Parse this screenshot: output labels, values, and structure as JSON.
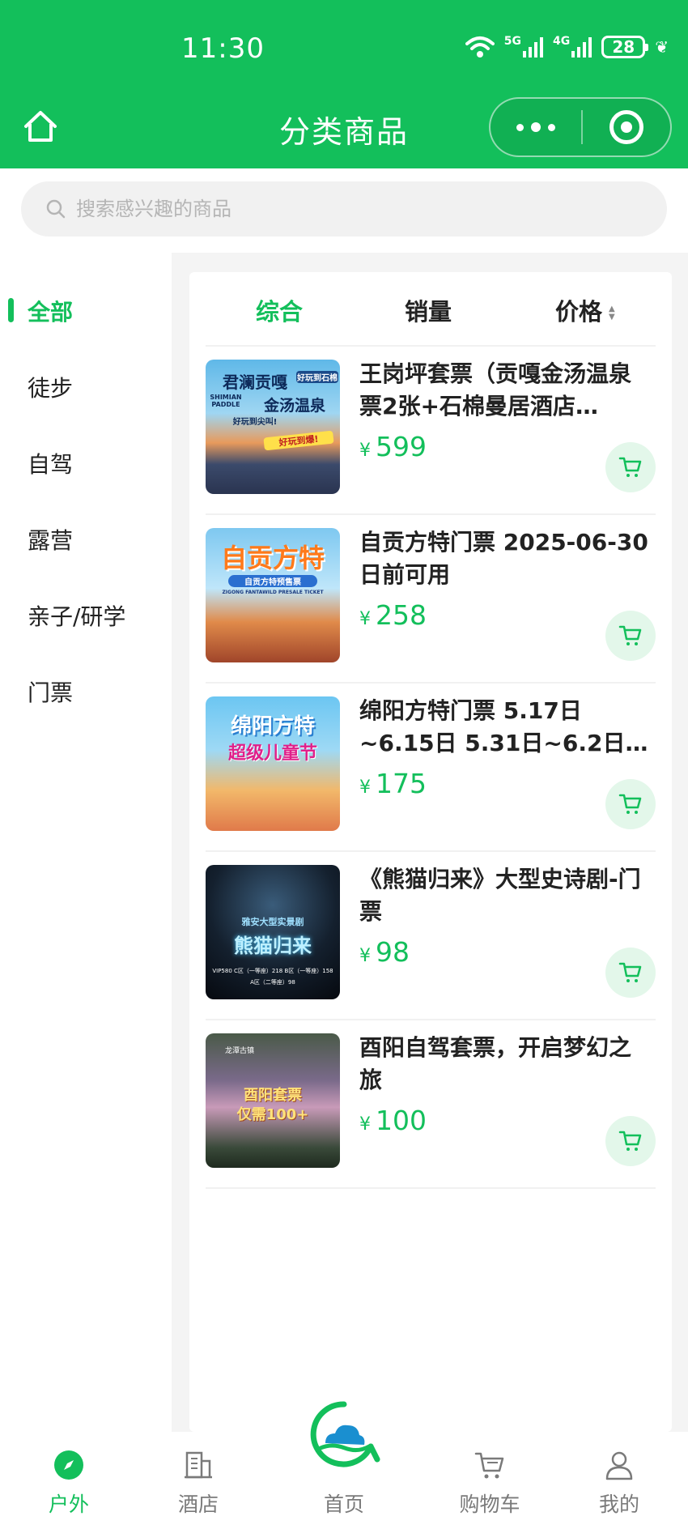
{
  "status_bar": {
    "time": "11:30",
    "net1": "5G",
    "net2": "4G",
    "battery": "28"
  },
  "nav": {
    "title": "分类商品"
  },
  "search": {
    "placeholder": "搜索感兴趣的商品"
  },
  "categories": [
    "全部",
    "徒步",
    "自驾",
    "露营",
    "亲子/研学",
    "门票"
  ],
  "sort": {
    "comprehensive": "综合",
    "sales": "销量",
    "price": "价格"
  },
  "currency": "¥",
  "products": [
    {
      "title": "王岗坪套票（贡嘎金汤温泉票2张+石棉曼居酒店…",
      "price": "599",
      "thumb_lines": [
        "君澜贡嘎",
        "好玩到石棉",
        "SHIMIAN PADDLE",
        "金汤温泉",
        "好玩到尖叫!",
        "好玩到爆!"
      ]
    },
    {
      "title": "自贡方特门票 2025-06-30日前可用",
      "price": "258",
      "thumb_lines": [
        "自贡方特",
        "自贡方特预售票",
        "ZIGONG FANTAWILD PRESALE TICKET"
      ]
    },
    {
      "title": "绵阳方特门票 5.17日~6.15日 5.31日~6.2日 …",
      "price": "175",
      "thumb_lines": [
        "绵阳方特",
        "超级儿童节"
      ]
    },
    {
      "title": "《熊猫归来》大型史诗剧-门票",
      "price": "98",
      "thumb_lines": [
        "雅安大型实景剧",
        "熊猫归来",
        "VIP580 C区（一等座）218 B区（一等座）158",
        "A区（二等座）98"
      ]
    },
    {
      "title": "酉阳自驾套票，开启梦幻之旅",
      "price": "100",
      "thumb_lines": [
        "龙潭古镇",
        "酉阳套票",
        "仅需100+"
      ]
    }
  ],
  "tabbar": {
    "outdoor": "户外",
    "hotel": "酒店",
    "home": "首页",
    "cart": "购物车",
    "mine": "我的"
  }
}
